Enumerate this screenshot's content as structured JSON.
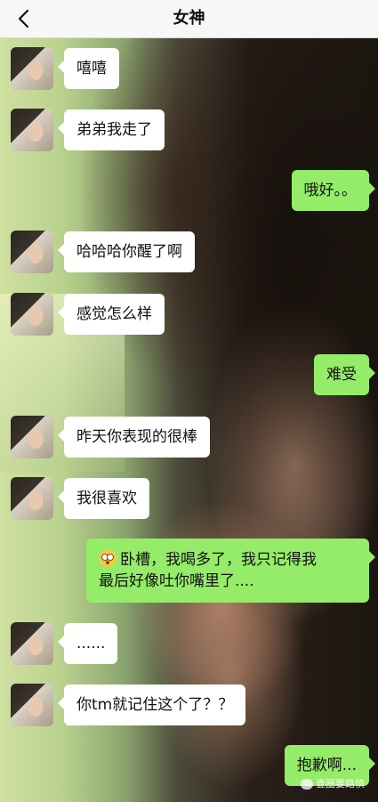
{
  "header": {
    "title": "女神"
  },
  "messages": [
    {
      "side": "left",
      "text": "嘻嘻"
    },
    {
      "side": "left",
      "text": "弟弟我走了"
    },
    {
      "side": "right",
      "text": "哦好。。"
    },
    {
      "side": "left",
      "text": "哈哈哈你醒了啊"
    },
    {
      "side": "left",
      "text": "感觉怎么样"
    },
    {
      "side": "right",
      "text": "难受"
    },
    {
      "side": "left",
      "text": "昨天你表现的很棒"
    },
    {
      "side": "left",
      "text": "我很喜欢"
    },
    {
      "side": "right",
      "line1": "卧槽，我喝多了，我只记得我",
      "line2": "最后好像吐你嘴里了....",
      "emoji": "flushed-face-icon"
    },
    {
      "side": "left",
      "text": "......"
    },
    {
      "side": "left",
      "text": "你tm就记住这个了？？"
    },
    {
      "side": "right",
      "text": "抱歉啊..."
    }
  ],
  "watermark": {
    "text": "壹圈要路慎",
    "icon": "wechat-icon"
  },
  "colors": {
    "bubble_self": "#95ec69",
    "bubble_other": "#ffffff",
    "navbar": "#f7f7f7"
  }
}
